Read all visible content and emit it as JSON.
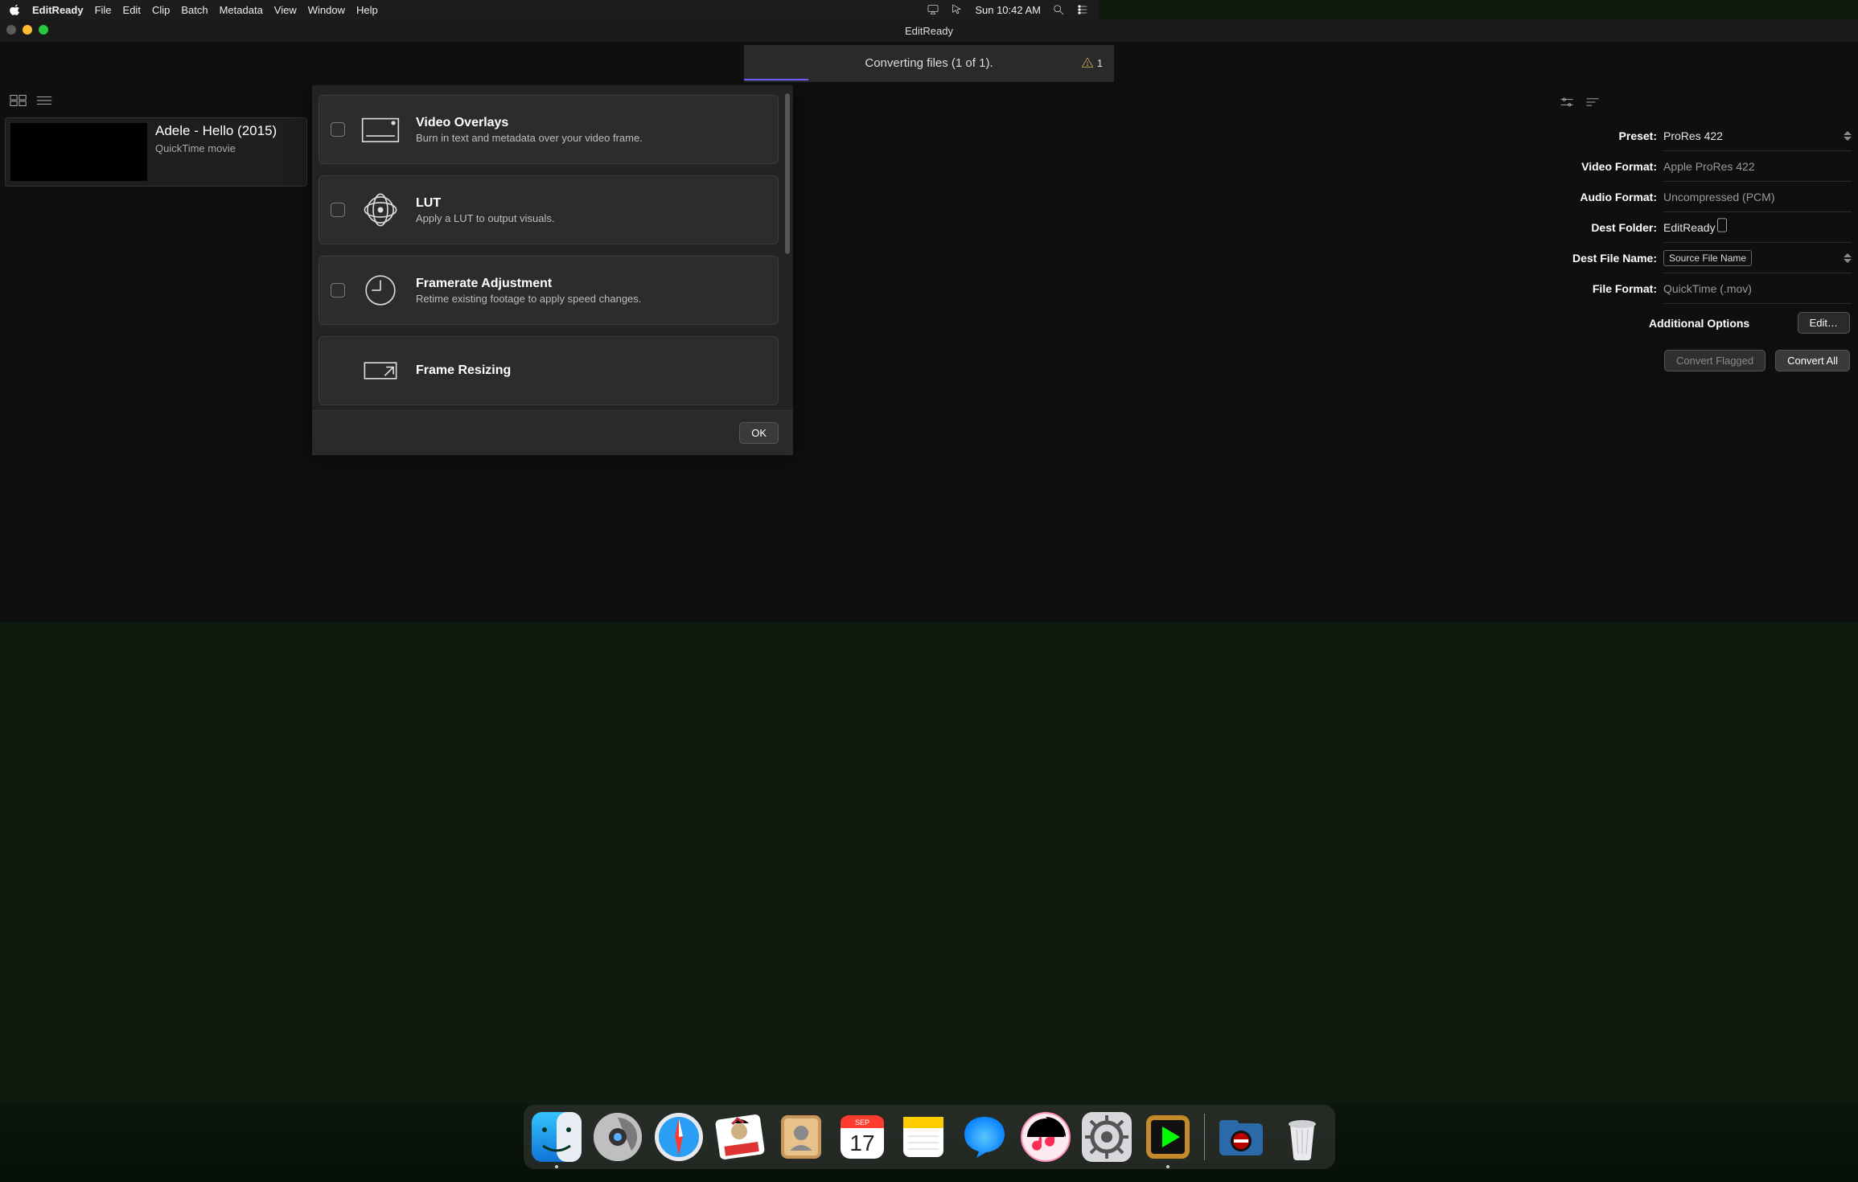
{
  "menubar": {
    "app": "EditReady",
    "items": [
      "File",
      "Edit",
      "Clip",
      "Batch",
      "Metadata",
      "View",
      "Window",
      "Help"
    ],
    "right_time": "Sun 10:42 AM"
  },
  "window": {
    "title": "EditReady"
  },
  "status": {
    "text": "Converting files (1 of 1).",
    "warning_count": "1"
  },
  "clip": {
    "title": "Adele - Hello (2015)",
    "subtitle": "QuickTime movie"
  },
  "settings": {
    "preset_label": "Preset:",
    "preset_value": "ProRes 422",
    "vformat_label": "Video Format:",
    "vformat_value": "Apple ProRes 422",
    "aformat_label": "Audio Format:",
    "aformat_value": "Uncompressed (PCM)",
    "dest_label": "Dest Folder:",
    "dest_value": "EditReady",
    "fname_label": "Dest File Name:",
    "fname_value": "Source File Name",
    "fformat_label": "File Format:",
    "fformat_value": "QuickTime (.mov)",
    "additional_label": "Additional Options",
    "edit_btn": "Edit…",
    "convert_flagged": "Convert Flagged",
    "convert_all": "Convert All"
  },
  "options": [
    {
      "title": "Video Overlays",
      "desc": "Burn in text and metadata over your video frame.",
      "icon": "video-overlay-icon"
    },
    {
      "title": "LUT",
      "desc": "Apply a LUT to output visuals.",
      "icon": "lut-icon"
    },
    {
      "title": "Framerate Adjustment",
      "desc": "Retime existing footage to apply speed changes.",
      "icon": "clock-icon"
    },
    {
      "title": "Frame Resizing",
      "desc": "",
      "icon": "resize-icon"
    }
  ],
  "modal": {
    "ok": "OK"
  },
  "dock": {
    "items": [
      "finder",
      "launchpad",
      "safari",
      "mail",
      "contacts",
      "calendar",
      "notes",
      "messages",
      "music",
      "settings",
      "editready"
    ],
    "items2": [
      "hal",
      "trash"
    ],
    "calendar_month": "SEP",
    "calendar_day": "17",
    "running": [
      "finder",
      "editready"
    ]
  }
}
